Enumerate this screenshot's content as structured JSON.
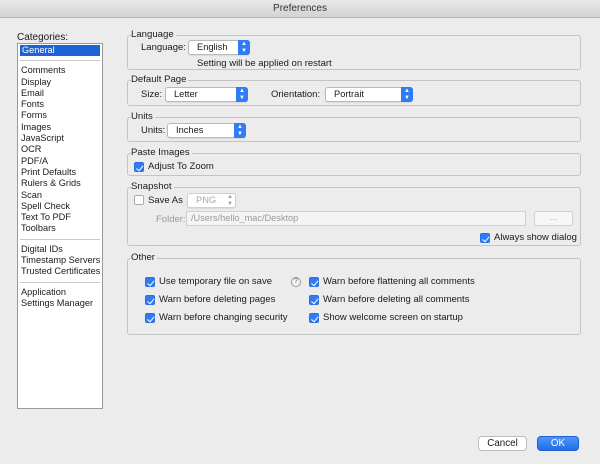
{
  "window": {
    "title": "Preferences"
  },
  "categories": {
    "label": "Categories:",
    "groups": [
      [
        "General"
      ],
      [
        "Comments",
        "Display",
        "Email",
        "Fonts",
        "Forms",
        "Images",
        "JavaScript",
        "OCR",
        "PDF/A",
        "Print Defaults",
        "Rulers & Grids",
        "Scan",
        "Spell Check",
        "Text To PDF",
        "Toolbars"
      ],
      [
        "Digital IDs",
        "Timestamp Servers",
        "Trusted Certificates"
      ],
      [
        "Application",
        "Settings Manager"
      ]
    ],
    "selected": "General"
  },
  "language": {
    "title": "Language",
    "label": "Language:",
    "value": "English",
    "note": "Setting will be applied on restart"
  },
  "default_page": {
    "title": "Default Page",
    "size_label": "Size:",
    "size_value": "Letter",
    "orientation_label": "Orientation:",
    "orientation_value": "Portrait"
  },
  "units": {
    "title": "Units",
    "label": "Units:",
    "value": "Inches"
  },
  "paste_images": {
    "title": "Paste Images",
    "adjust_label": "Adjust To Zoom",
    "adjust_checked": true
  },
  "snapshot": {
    "title": "Snapshot",
    "save_as_label": "Save As",
    "save_as_checked": false,
    "format_value": "PNG",
    "folder_label": "Folder:",
    "folder_value": "/Users/hello_mac/Desktop",
    "browse_label": "...",
    "always_show_label": "Always show dialog",
    "always_show_checked": true
  },
  "other": {
    "title": "Other",
    "help_glyph": "?",
    "options": {
      "temp_file": {
        "label": "Use temporary file on save",
        "checked": true
      },
      "warn_delete_pages": {
        "label": "Warn before deleting pages",
        "checked": true
      },
      "warn_security": {
        "label": "Warn before changing security",
        "checked": true
      },
      "warn_flatten": {
        "label": "Warn before flattening all comments",
        "checked": true
      },
      "warn_delete_comments": {
        "label": "Warn before deleting all comments",
        "checked": true
      },
      "welcome_screen": {
        "label": "Show welcome screen on startup",
        "checked": true
      }
    }
  },
  "footer": {
    "cancel_label": "Cancel",
    "ok_label": "OK"
  },
  "colors": {
    "accent": "#2f7cf6",
    "selection": "#1c63d6",
    "window_bg": "#ececec"
  }
}
